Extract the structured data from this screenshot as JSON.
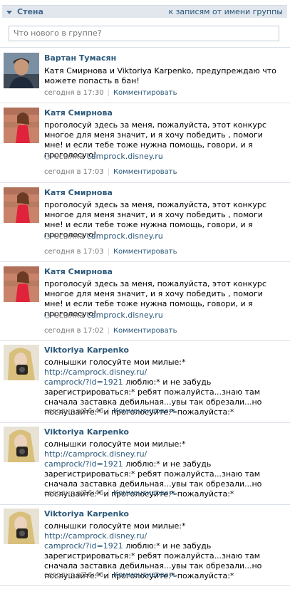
{
  "header": {
    "title": "Стена",
    "link": "к записям от имени группы"
  },
  "composer": {
    "placeholder": "Что нового в группе?"
  },
  "attach_label": "Ссылка",
  "comment_label": "Комментировать",
  "posts": [
    {
      "author": "Вартан Тумасян",
      "text": "Катя Смирнова и Viktoriya Karpenko, предупреждаю что можете попасть в бан!",
      "time": "сегодня в 17:30",
      "avatar": "photo-man"
    },
    {
      "author": "Катя Смирнова",
      "text": "проголосуй здесь за меня, пожалуйста, этот конкурс многое для меня значит, и я хочу победить , помоги мне! и если тебе тоже нужна помощь, говори, и я проголосую!",
      "link": "camprock.disney.ru",
      "time": "сегодня в 17:03",
      "avatar": "photo-girl-red"
    },
    {
      "author": "Катя Смирнова",
      "text": "проголосуй здесь за меня, пожалуйста, этот конкурс многое для меня значит, и я хочу победить , помоги мне! и если тебе тоже нужна помощь, говори, и я проголосую!",
      "link": "camprock.disney.ru",
      "time": "сегодня в 17:03",
      "avatar": "photo-girl-red"
    },
    {
      "author": "Катя Смирнова",
      "text": "проголосуй здесь за меня, пожалуйста, этот конкурс многое для меня значит, и я хочу победить , помоги мне! и если тебе тоже нужна помощь, говори, и я проголосую!",
      "link": "camprock.disney.ru",
      "time": "сегодня в 17:02",
      "avatar": "photo-girl-red"
    },
    {
      "author": "Viktoriya Karpenko",
      "text_a": "солнышки голосуйте мои милые:* ",
      "url1": "http://camprock.disney.ru/",
      "url2": "camprock/?id=1921",
      "text_b": " люблю:* и не забудь зарегистрироваться:* ребят пожалуйста...знаю там сначала заставка дебильная...увы так обрезали...но послушайте:* и проголосуйте:* пожалуйста:*",
      "time": "сегодня в 16:46",
      "avatar": "photo-girl-blonde"
    },
    {
      "author": "Viktoriya Karpenko",
      "text_a": "солнышки голосуйте мои милые:* ",
      "url1": "http://camprock.disney.ru/",
      "url2": "camprock/?id=1921",
      "text_b": " люблю:* и не забудь зарегистрироваться:* ребят пожалуйста...знаю там сначала заставка дебильная...увы так обрезали...но послушайте:* и проголосуйте:* пожалуйста:*",
      "time": "сегодня в 16:46",
      "avatar": "photo-girl-blonde"
    },
    {
      "author": "Viktoriya Karpenko",
      "text_a": "солнышки голосуйте мои милые:* ",
      "url1": "http://camprock.disney.ru/",
      "url2": "camprock/?id=1921",
      "text_b": " люблю:* и не забудь зарегистрироваться:* ребят пожалуйста...знаю там сначала заставка дебильная...увы так обрезали...но послушайте:* и проголосуйте:* пожалуйста:*",
      "time": "сегодня в 16:46",
      "avatar": "photo-girl-blonde"
    }
  ],
  "colors": {
    "link": "#2b587a",
    "header_bg": "#e1e7ed",
    "meta": "#777777"
  }
}
